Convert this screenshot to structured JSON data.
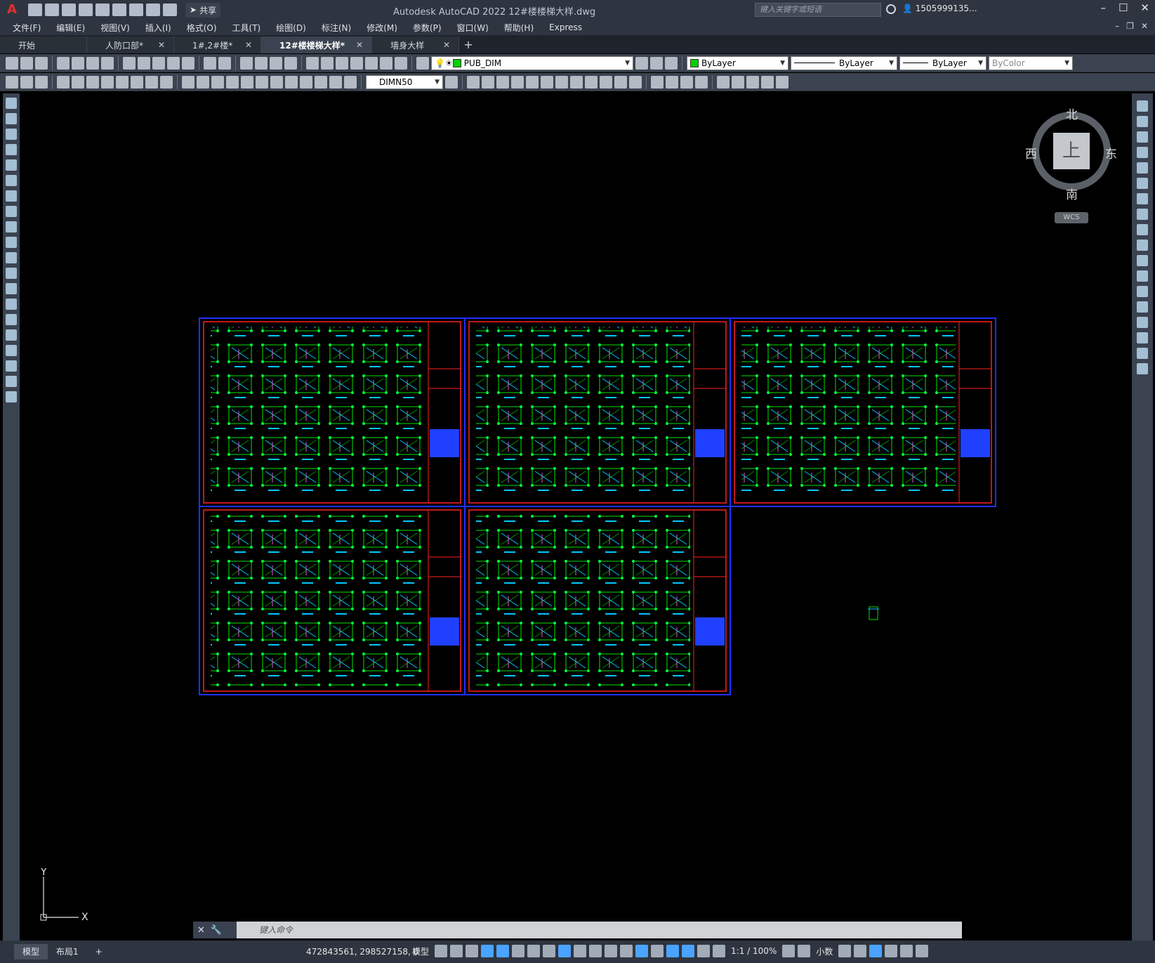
{
  "app": {
    "title": "Autodesk AutoCAD 2022    12#楼楼梯大样.dwg",
    "share_label": "共享",
    "search_placeholder": "键入关键字或短语",
    "user_label": "1505999135...",
    "logo_letter": "A"
  },
  "menu": {
    "items": [
      "文件(F)",
      "编辑(E)",
      "视图(V)",
      "插入(I)",
      "格式(O)",
      "工具(T)",
      "绘图(D)",
      "标注(N)",
      "修改(M)",
      "参数(P)",
      "窗口(W)",
      "帮助(H)",
      "Express"
    ]
  },
  "tabs": [
    {
      "label": "开始",
      "closable": false,
      "active": false
    },
    {
      "label": "人防口部*",
      "closable": true,
      "active": false
    },
    {
      "label": "1#,2#楼*",
      "closable": true,
      "active": false
    },
    {
      "label": "12#楼楼梯大样*",
      "closable": true,
      "active": true
    },
    {
      "label": "墙身大样",
      "closable": true,
      "active": false
    }
  ],
  "properties": {
    "layer": "PUB_DIM",
    "color": "ByLayer",
    "linetype": "ByLayer",
    "lineweight": "ByLayer",
    "plotstyle": "ByColor",
    "dimstyle": "DIMN50",
    "layer_color": "#00d000"
  },
  "viewcube": {
    "top": "北",
    "bottom": "南",
    "left": "西",
    "right": "东",
    "face": "上",
    "wcs": "WCS"
  },
  "ucs": {
    "x": "X",
    "y": "Y"
  },
  "command": {
    "placeholder": "键入命令"
  },
  "status": {
    "tabs": [
      "模型",
      "布局1"
    ],
    "coords": "472843561, 298527158, 0",
    "model_label": "模型",
    "scale": "1:1 / 100%",
    "units": "小数"
  }
}
